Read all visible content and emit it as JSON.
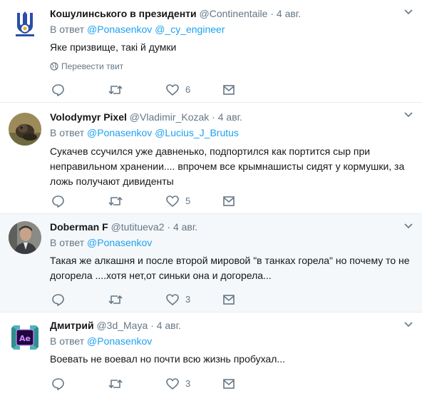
{
  "tweets": [
    {
      "name": "Кошулинського в президенти",
      "handle": "@Continentaile",
      "dot": "·",
      "time": "4 авг.",
      "reply_prefix": "В ответ",
      "mentions": [
        "@Ponasenkov",
        "@_cy_engineer"
      ],
      "text": "Яке призвище, такі й думки",
      "translate": "Перевести твит",
      "likes": "6"
    },
    {
      "name": "Volodymyr Pixel",
      "handle": "@Vladimir_Kozak",
      "dot": "·",
      "time": "4 авг.",
      "reply_prefix": "В ответ",
      "mentions": [
        "@Ponasenkov",
        "@Lucius_J_Brutus"
      ],
      "text": "Сукачев ссучился уже давненько, подпортился как портится сыр при неправильном хранении.... впрочем все крымнашисты сидят у кормушки, за ложь получают дивиденты",
      "likes": "5"
    },
    {
      "name": "Doberman F",
      "handle": "@tutitueva2",
      "dot": "·",
      "time": "4 авг.",
      "reply_prefix": "В ответ",
      "mentions": [
        "@Ponasenkov"
      ],
      "text": "Такая же алкашня и после второй мировой \"в танках горела\" но почему то не догорела ....хотя нет,от синьки она и догорела...",
      "likes": "3"
    },
    {
      "name": "Дмитрий",
      "handle": "@3d_Maya",
      "dot": "·",
      "time": "4 авг.",
      "reply_prefix": "В ответ",
      "mentions": [
        "@Ponasenkov"
      ],
      "text": "Воевать не воевал но почти всю жизнь пробухал...",
      "likes": "3"
    }
  ],
  "avatar_icons": [
    "trident-logo",
    "dog-photo",
    "man-photo",
    "ae-logo"
  ],
  "colors": {
    "link": "#1da1f2",
    "muted": "#657786",
    "highlight_bg": "#f5f8fa",
    "border": "#e6ecf0"
  }
}
